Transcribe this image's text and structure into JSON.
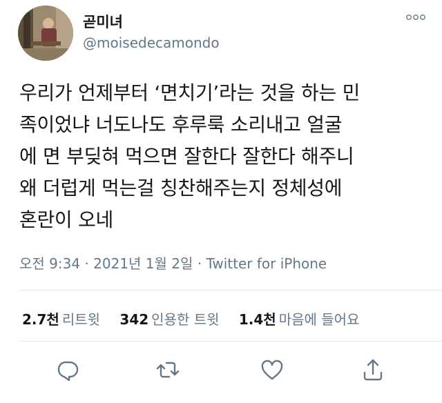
{
  "user": {
    "display_name": "곧미녀",
    "handle": "@moisedecamondo",
    "more_icon": "more-dots-icon"
  },
  "tweet": {
    "text": "우리가 언제부터 ‘면치기’라는 것을 하는 민\n족이었냐 너도나도 후루룩 소리내고 얼굴\n에 면 부딪혀 먹으면 잘한다 잘한다 해주니\n왜 더럽게 먹는걸 칭찬해주는지 정체성에\n혼란이 오네",
    "timestamp": "오전 9:34 · 2021년 1월 2일 · ",
    "source": "Twitter for iPhone"
  },
  "stats": {
    "retweets_count": "2.7천",
    "retweets_label": "리트윗",
    "quotes_count": "342",
    "quotes_label": "인용한 트윗",
    "likes_count": "1.4천",
    "likes_label": "마음에 들어요"
  },
  "actions": [
    "reply-icon",
    "retweet-icon",
    "like-icon",
    "share-icon"
  ],
  "colors": {
    "text": "#14171a",
    "secondary": "#657786",
    "divider": "#e1e8ed"
  }
}
